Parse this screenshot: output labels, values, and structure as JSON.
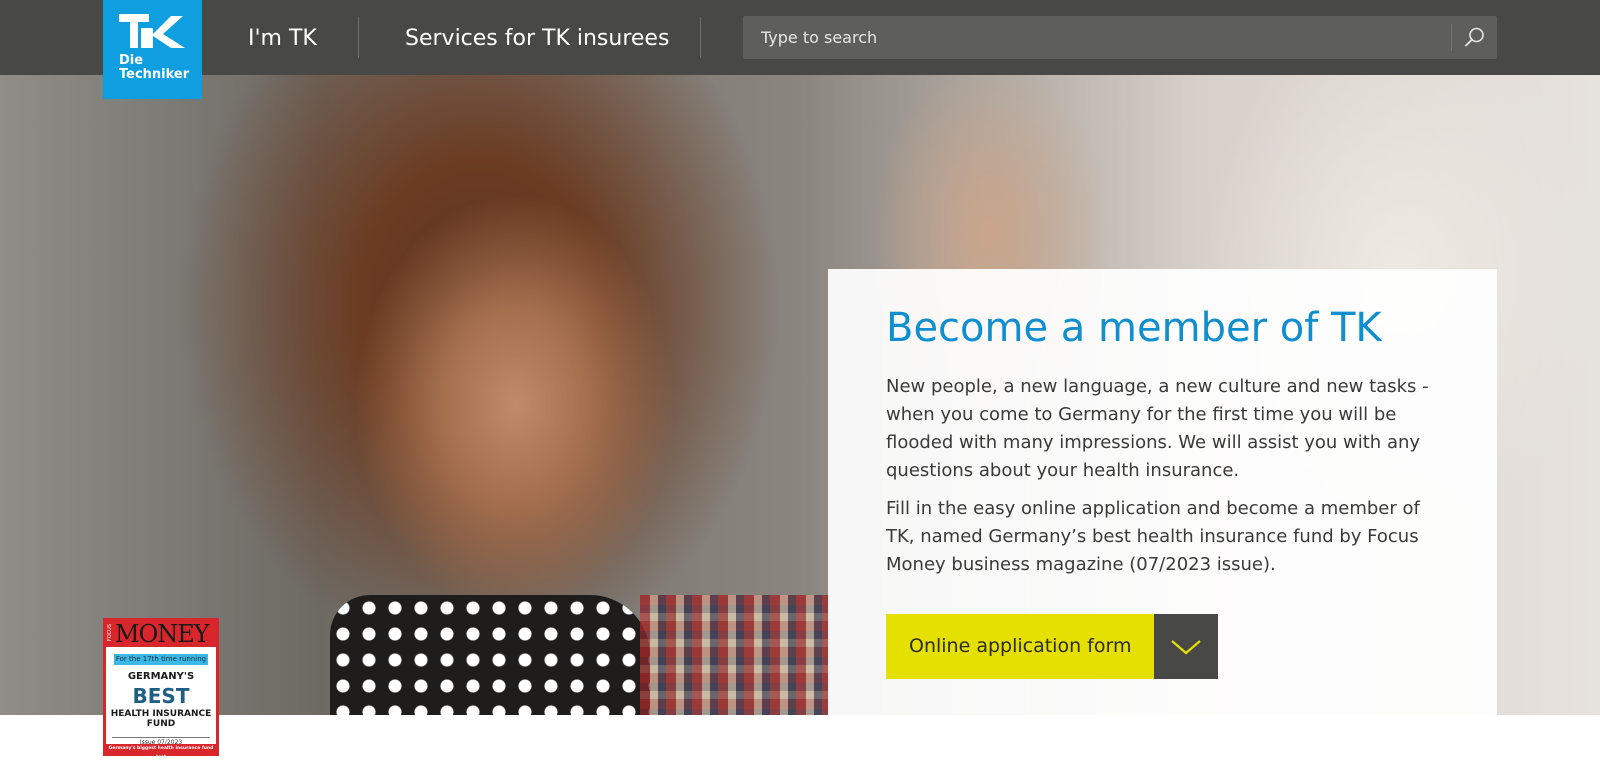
{
  "header": {
    "logo_text_line1": "Die",
    "logo_text_line2": "Techniker",
    "nav": [
      {
        "label": "I'm TK"
      },
      {
        "label": "Services for TK insurees"
      }
    ],
    "search": {
      "placeholder": "Type to search",
      "icon": "search-icon"
    }
  },
  "hero": {
    "title": "Become a member of TK",
    "paragraph1": "New people, a new language, a new culture and new tasks - when you come to Germany for the first time you will be flooded with many impressions. We will assist you with any questions about your health insurance.",
    "paragraph2": "Fill in the easy online application and become a member of TK, named Germany’s best health insurance fund by Focus Money business magazine (07/2023 issue).",
    "cta_label": "Online application form",
    "cta_toggle_icon": "chevron-down-icon"
  },
  "badge": {
    "brand_small": "FOCUS",
    "brand": "MONEY",
    "streak": "For the 17th time running",
    "line1": "GERMANY'S",
    "line2": "BEST",
    "line3a": "HEALTH INSURANCE",
    "line3b": "FUND",
    "issue": "Issue 07/2023",
    "footer": "Germany's biggest health insurance fund test"
  },
  "colors": {
    "header_bg": "#484846",
    "brand_blue": "#0f9fe1",
    "title_blue": "#0f8ed0",
    "cta_yellow": "#e6e000"
  }
}
